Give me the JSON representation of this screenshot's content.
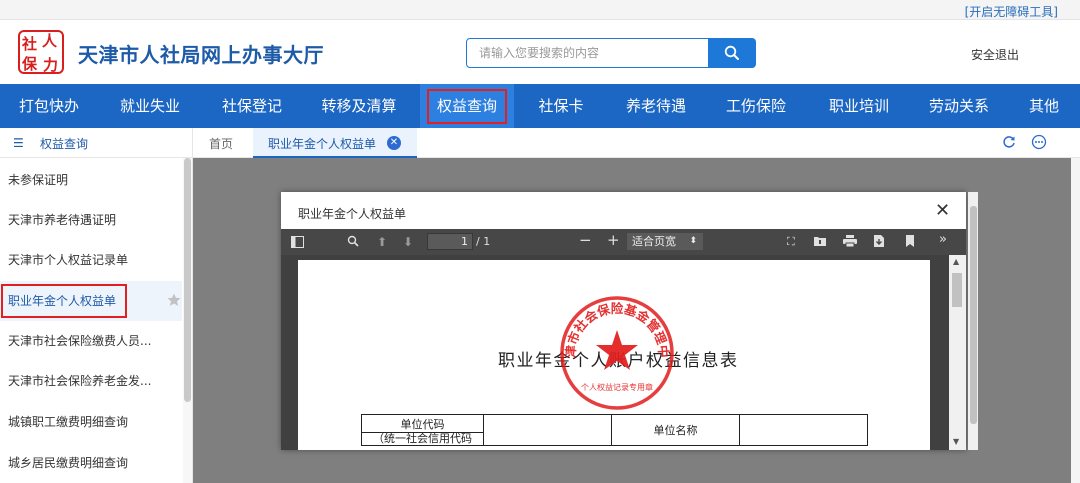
{
  "topbar": {
    "accessibility": "[开启无障碍工具]"
  },
  "header": {
    "logo_chars": [
      "社",
      "人",
      "保",
      "力"
    ],
    "title": "天津市人社局网上办事大厅",
    "search_placeholder": "请输入您要搜索的内容",
    "logout": "安全退出"
  },
  "nav": {
    "items": [
      "打包快办",
      "就业失业",
      "社保登记",
      "转移及清算",
      "权益查询",
      "社保卡",
      "养老待遇",
      "工伤保险",
      "职业培训",
      "劳动关系",
      "其他"
    ],
    "active_index": 4
  },
  "sidebar": {
    "header": "权益查询",
    "items": [
      "未参保证明",
      "天津市养老待遇证明",
      "天津市个人权益记录单",
      "职业年金个人权益单",
      "天津市社会保险缴费人员...",
      "天津市社会保险养老金发...",
      "城镇职工缴费明细查询",
      "城乡居民缴费明细查询"
    ],
    "active_index": 3
  },
  "tabs": {
    "home": "首页",
    "active": "职业年金个人权益单"
  },
  "modal": {
    "title": "职业年金个人权益单",
    "pdf": {
      "page_current": "1",
      "page_total": "/ 1",
      "zoom": "适合页宽",
      "heading": "职业年金个人账户权益信息表",
      "stamp_text": "天津市社会保险基金管理中心",
      "stamp_sub": "个人权益记录专用章",
      "table": {
        "unit_code": "单位代码",
        "unit_code_sub": "（统一社会信用代码",
        "unit_name": "单位名称"
      }
    }
  },
  "colors": {
    "nav_bg": "#1c66c4",
    "nav_active": "#2d7fe0",
    "highlight_red": "#e32020",
    "brand_blue": "#1d5aa8"
  }
}
